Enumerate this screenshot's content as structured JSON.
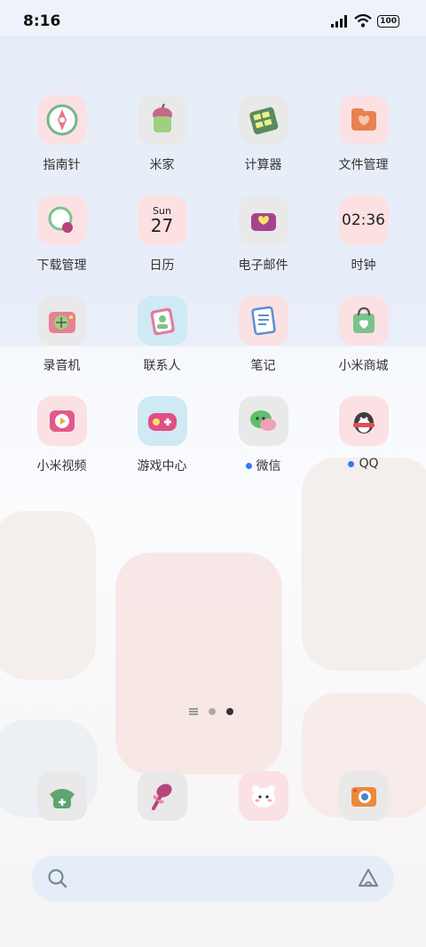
{
  "status_bar": {
    "time": "8:16",
    "battery": "100",
    "icons": [
      "signal-icon",
      "wifi-icon",
      "battery-icon"
    ]
  },
  "apps": [
    {
      "label": "指南针",
      "icon": "compass-icon",
      "bg": "#fbe1e3"
    },
    {
      "label": "米家",
      "icon": "mi-home-icon",
      "bg": "#e9e9e9"
    },
    {
      "label": "计算器",
      "icon": "calculator-icon",
      "bg": "#e9e9e9"
    },
    {
      "label": "文件管理",
      "icon": "file-manager-icon",
      "bg": "#fbe1e3"
    },
    {
      "label": "下载管理",
      "icon": "download-icon",
      "bg": "#fbe1e3"
    },
    {
      "label": "日历",
      "icon": "calendar-icon",
      "bg": "#fde0e2",
      "day": "Sun",
      "date": "27"
    },
    {
      "label": "电子邮件",
      "icon": "email-icon",
      "bg": "#e9e9e9"
    },
    {
      "label": "时钟",
      "icon": "clock-icon",
      "bg": "#fde0e2",
      "clock": "02:36"
    },
    {
      "label": "录音机",
      "icon": "recorder-icon",
      "bg": "#e9e9e9"
    },
    {
      "label": "联系人",
      "icon": "contacts-icon",
      "bg": "#cfe9f5"
    },
    {
      "label": "笔记",
      "icon": "notes-icon",
      "bg": "#fbe1e3"
    },
    {
      "label": "小米商城",
      "icon": "mi-store-icon",
      "bg": "#fbe1e3"
    },
    {
      "label": "小米视频",
      "icon": "mi-video-icon",
      "bg": "#fbe1e3"
    },
    {
      "label": "游戏中心",
      "icon": "game-center-icon",
      "bg": "#cfe9f5"
    },
    {
      "label": "微信",
      "icon": "wechat-icon",
      "bg": "#e9e9e9",
      "badge": true
    },
    {
      "label": "QQ",
      "icon": "qq-icon",
      "bg": "#fbe1e3",
      "badge": true
    }
  ],
  "dock": [
    {
      "icon": "phone-icon",
      "bg": "#e9e9e9"
    },
    {
      "icon": "messages-icon",
      "bg": "#e9e9e9"
    },
    {
      "icon": "gallery-icon",
      "bg": "#fbe1e3"
    },
    {
      "icon": "camera-icon",
      "bg": "#e9e9e9"
    }
  ],
  "page_indicator": {
    "pages": 2,
    "active": 2
  },
  "search_bar": {
    "icons": [
      "search-icon",
      "assistant-icon"
    ]
  },
  "colors": {
    "badge": "#2f7bf2",
    "label_text": "#333333",
    "search_bg": "#e2ecfa"
  }
}
